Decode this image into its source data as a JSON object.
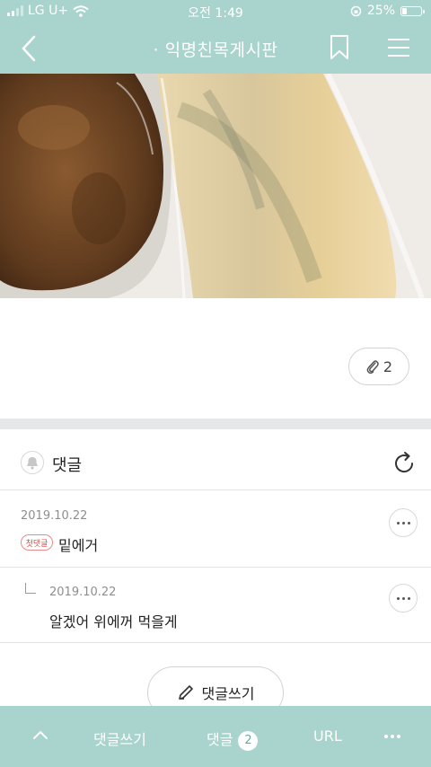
{
  "status_bar": {
    "carrier": "LG U+",
    "time": "오전 1:49",
    "battery": "25%"
  },
  "nav": {
    "title": "· 익명친목게시판"
  },
  "attachment": {
    "count": "2"
  },
  "comments_section": {
    "header_label": "댓글",
    "items": [
      {
        "date": "2019.10.22",
        "badge": "첫댓글",
        "text": "밑에거"
      },
      {
        "date": "2019.10.22",
        "text": "알겠어 위에꺼 먹을게"
      }
    ]
  },
  "write_button": {
    "label": "댓글쓰기"
  },
  "bottom_bar": {
    "write_label": "댓글쓰기",
    "comments_label": "댓글",
    "comments_count": "2",
    "url_label": "URL"
  },
  "colors": {
    "accent": "#a9d3cd",
    "badge_red": "#d94b4b",
    "divider": "#e6e7e8"
  },
  "icons": [
    "back-arrow-icon",
    "bookmark-icon",
    "menu-icon",
    "paperclip-icon",
    "bell-icon",
    "refresh-icon",
    "more-icon",
    "pencil-icon",
    "chevron-up-icon"
  ]
}
